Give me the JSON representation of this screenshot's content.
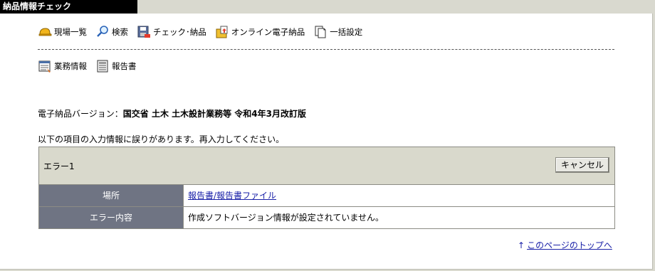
{
  "tab": {
    "title": "納品情報チェック"
  },
  "nav": {
    "primary": [
      {
        "label": "現場一覧",
        "icon": "helmet-icon"
      },
      {
        "label": "検索",
        "icon": "magnifier-icon"
      },
      {
        "label": "チェック･納品",
        "icon": "floppy-check-icon"
      },
      {
        "label": "オンライン電子納品",
        "icon": "online-delivery-icon"
      },
      {
        "label": "一括設定",
        "icon": "documents-icon"
      }
    ],
    "secondary": [
      {
        "label": "業務情報",
        "icon": "business-info-icon"
      },
      {
        "label": "報告書",
        "icon": "report-icon"
      }
    ]
  },
  "version": {
    "label": "電子納品バージョン：",
    "value": "国交省 土木 土木設計業務等 令和4年3月改訂版"
  },
  "message": "以下の項目の入力情報に誤りがあります。再入力してください。",
  "error": {
    "title": "エラー1",
    "cancel_label": "キャンセル",
    "rows": [
      {
        "label": "場所",
        "value": "報告書/報告書ファイル"
      },
      {
        "label": "エラー内容",
        "value": "作成ソフトバージョン情報が設定されていません。"
      }
    ]
  },
  "footer": {
    "arrow": "↑",
    "top_link": "このページのトップへ"
  },
  "colors": {
    "tab_bg": "#000000",
    "header_cell": "#6f7483",
    "error_head": "#d9d9cc",
    "link": "#1a21a8"
  }
}
